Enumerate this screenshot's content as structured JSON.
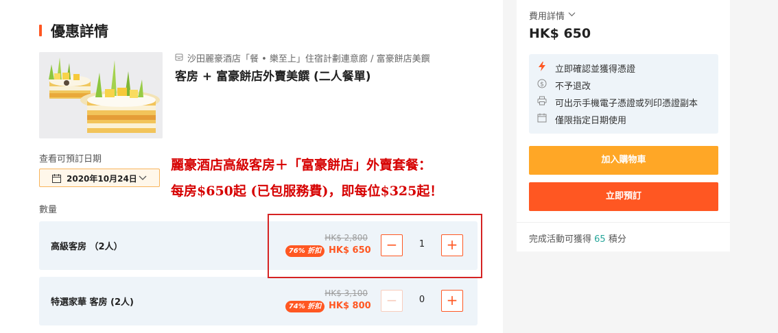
{
  "section_title": "優惠詳情",
  "product": {
    "location": "沙田麗豪酒店「餐 • 樂至上」住宿計劃連意廊 / 富豪餅店美饌",
    "title": "客房 + 富豪餅店外賣美饌 (二人餐單)",
    "image_icon": "pastry-photo"
  },
  "date": {
    "label": "查看可預訂日期",
    "value": "2020年10月24日"
  },
  "promo": {
    "line1": "麗豪酒店高級客房＋「富豪餅店」外賣套餐：",
    "line2": "每房$650起 (已包服務費)，即每位$325起！"
  },
  "quantity_label": "數量",
  "rooms": [
    {
      "name": "高級客房 （2人）",
      "original_price": "HK$ 2,800",
      "discount": "76% 折扣",
      "price": "HK$ 650",
      "quantity": "1",
      "minus_label": "−",
      "plus_label": "+"
    },
    {
      "name": "特選家華 客房 (2人)",
      "original_price": "HK$ 3,100",
      "discount": "74% 折扣",
      "price": "HK$ 800",
      "quantity": "0",
      "minus_label": "−",
      "plus_label": "+"
    }
  ],
  "summary": {
    "fee_label": "費用詳情",
    "total": "HK$ 650",
    "features": [
      {
        "icon": "lightning-icon",
        "text": "立即確認並獲得憑證"
      },
      {
        "icon": "no-refund-icon",
        "text": "不予退改"
      },
      {
        "icon": "printer-icon",
        "text": "可出示手機電子憑證或列印憑證副本"
      },
      {
        "icon": "calendar-icon",
        "text": "僅限指定日期使用"
      }
    ],
    "add_to_cart": "加入購物車",
    "book_now": "立即預訂",
    "points_prefix": "完成活動可獲得 ",
    "points_value": "65",
    "points_suffix": " 積分"
  },
  "colors": {
    "accent": "#ff5722",
    "cart_button": "#ffa726",
    "highlight_border": "#d52222",
    "promo_text": "#d60000",
    "points": "#26a69a"
  }
}
